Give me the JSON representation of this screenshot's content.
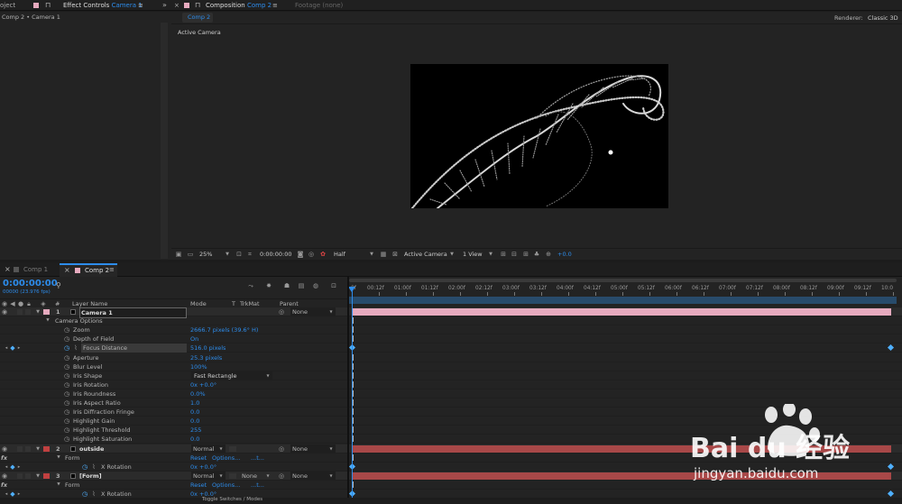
{
  "left_panel": {
    "tab_project": "oject",
    "tab_effect_controls": "Effect Controls",
    "tab_effect_target": "Camera 1",
    "breadcrumb": "Comp 2 • Camera 1"
  },
  "comp_panel": {
    "tab_label": "Composition",
    "tab_target": "Comp 2",
    "footage_tab": "Footage (none)",
    "subtab": "Comp 2",
    "renderer_label": "Renderer:",
    "renderer_value": "Classic 3D",
    "view_label": "Active Camera",
    "footer": {
      "zoom": "25%",
      "timecode": "0:00:00:00",
      "resolution": "Half",
      "camera": "Active Camera",
      "views": "1 View",
      "exposure": "+0.0"
    }
  },
  "timeline": {
    "tabs": [
      "Comp 1",
      "Comp 2"
    ],
    "timecode": "0:00:00:00",
    "fps": "00000 (23.976 fps)",
    "search_icon": "search-icon",
    "headers": {
      "num": "#",
      "layer_name": "Layer Name",
      "mode": "Mode",
      "t": "T",
      "trkmat": "TrkMat",
      "parent": "Parent"
    },
    "ticks": [
      "0f",
      "00:12f",
      "01:00f",
      "01:12f",
      "02:00f",
      "02:12f",
      "03:00f",
      "03:12f",
      "04:00f",
      "04:12f",
      "05:00f",
      "05:12f",
      "06:00f",
      "06:12f",
      "07:00f",
      "07:12f",
      "08:00f",
      "08:12f",
      "09:00f",
      "09:12f",
      "10:0"
    ],
    "rows": [
      {
        "kind": "layer",
        "num": "1",
        "name": "Camera 1",
        "color": "#e6aabe",
        "mode": "",
        "trkmat": "",
        "parent": "None"
      },
      {
        "kind": "group",
        "label": "Camera Options"
      },
      {
        "kind": "prop",
        "label": "Zoom",
        "value": "2666.7 pixels (39.6° H)"
      },
      {
        "kind": "prop",
        "label": "Depth of Field",
        "value": "On"
      },
      {
        "kind": "prop",
        "label": "Focus Distance",
        "value": "516.0 pixels",
        "keyed": true
      },
      {
        "kind": "prop",
        "label": "Aperture",
        "value": "25.3 pixels"
      },
      {
        "kind": "prop",
        "label": "Blur Level",
        "value": "100%"
      },
      {
        "kind": "prop",
        "label": "Iris Shape",
        "value": "Fast Rectangle",
        "dropdown": true
      },
      {
        "kind": "prop",
        "label": "Iris Rotation",
        "value": "0x +0.0°"
      },
      {
        "kind": "prop",
        "label": "Iris Roundness",
        "value": "0.0%"
      },
      {
        "kind": "prop",
        "label": "Iris Aspect Ratio",
        "value": "1.0"
      },
      {
        "kind": "prop",
        "label": "Iris Diffraction Fringe",
        "value": "0.0"
      },
      {
        "kind": "prop",
        "label": "Highlight Gain",
        "value": "0.0"
      },
      {
        "kind": "prop",
        "label": "Highlight Threshold",
        "value": "255"
      },
      {
        "kind": "prop",
        "label": "Highlight Saturation",
        "value": "0.0"
      },
      {
        "kind": "layer",
        "num": "2",
        "name": "outside",
        "color": "#c04040",
        "mode": "Normal",
        "trkmat": "",
        "parent": "None"
      },
      {
        "kind": "effect",
        "label": "Form",
        "reset": "Reset",
        "options": "Options...",
        "dots": "...t..."
      },
      {
        "kind": "prop2",
        "label": "X Rotation",
        "value": "0x +0.0°"
      },
      {
        "kind": "layer",
        "num": "3",
        "name": "[Form]",
        "color": "#c04040",
        "mode": "Normal",
        "trkmat": "None",
        "parent": "None"
      },
      {
        "kind": "effect",
        "label": "Form",
        "reset": "Reset",
        "options": "Options...",
        "dots": "...t..."
      },
      {
        "kind": "prop2",
        "label": "X Rotation",
        "value": "0x +0.0°"
      }
    ],
    "footer_label": "Toggle Switches / Modes"
  },
  "colors": {
    "accent": "#2d8ceb",
    "camera_bar": "#e6aabe",
    "layer_bar": "#a84848"
  },
  "watermark": {
    "brand": "Bai du 经验",
    "url": "jingyan.baidu.com"
  }
}
